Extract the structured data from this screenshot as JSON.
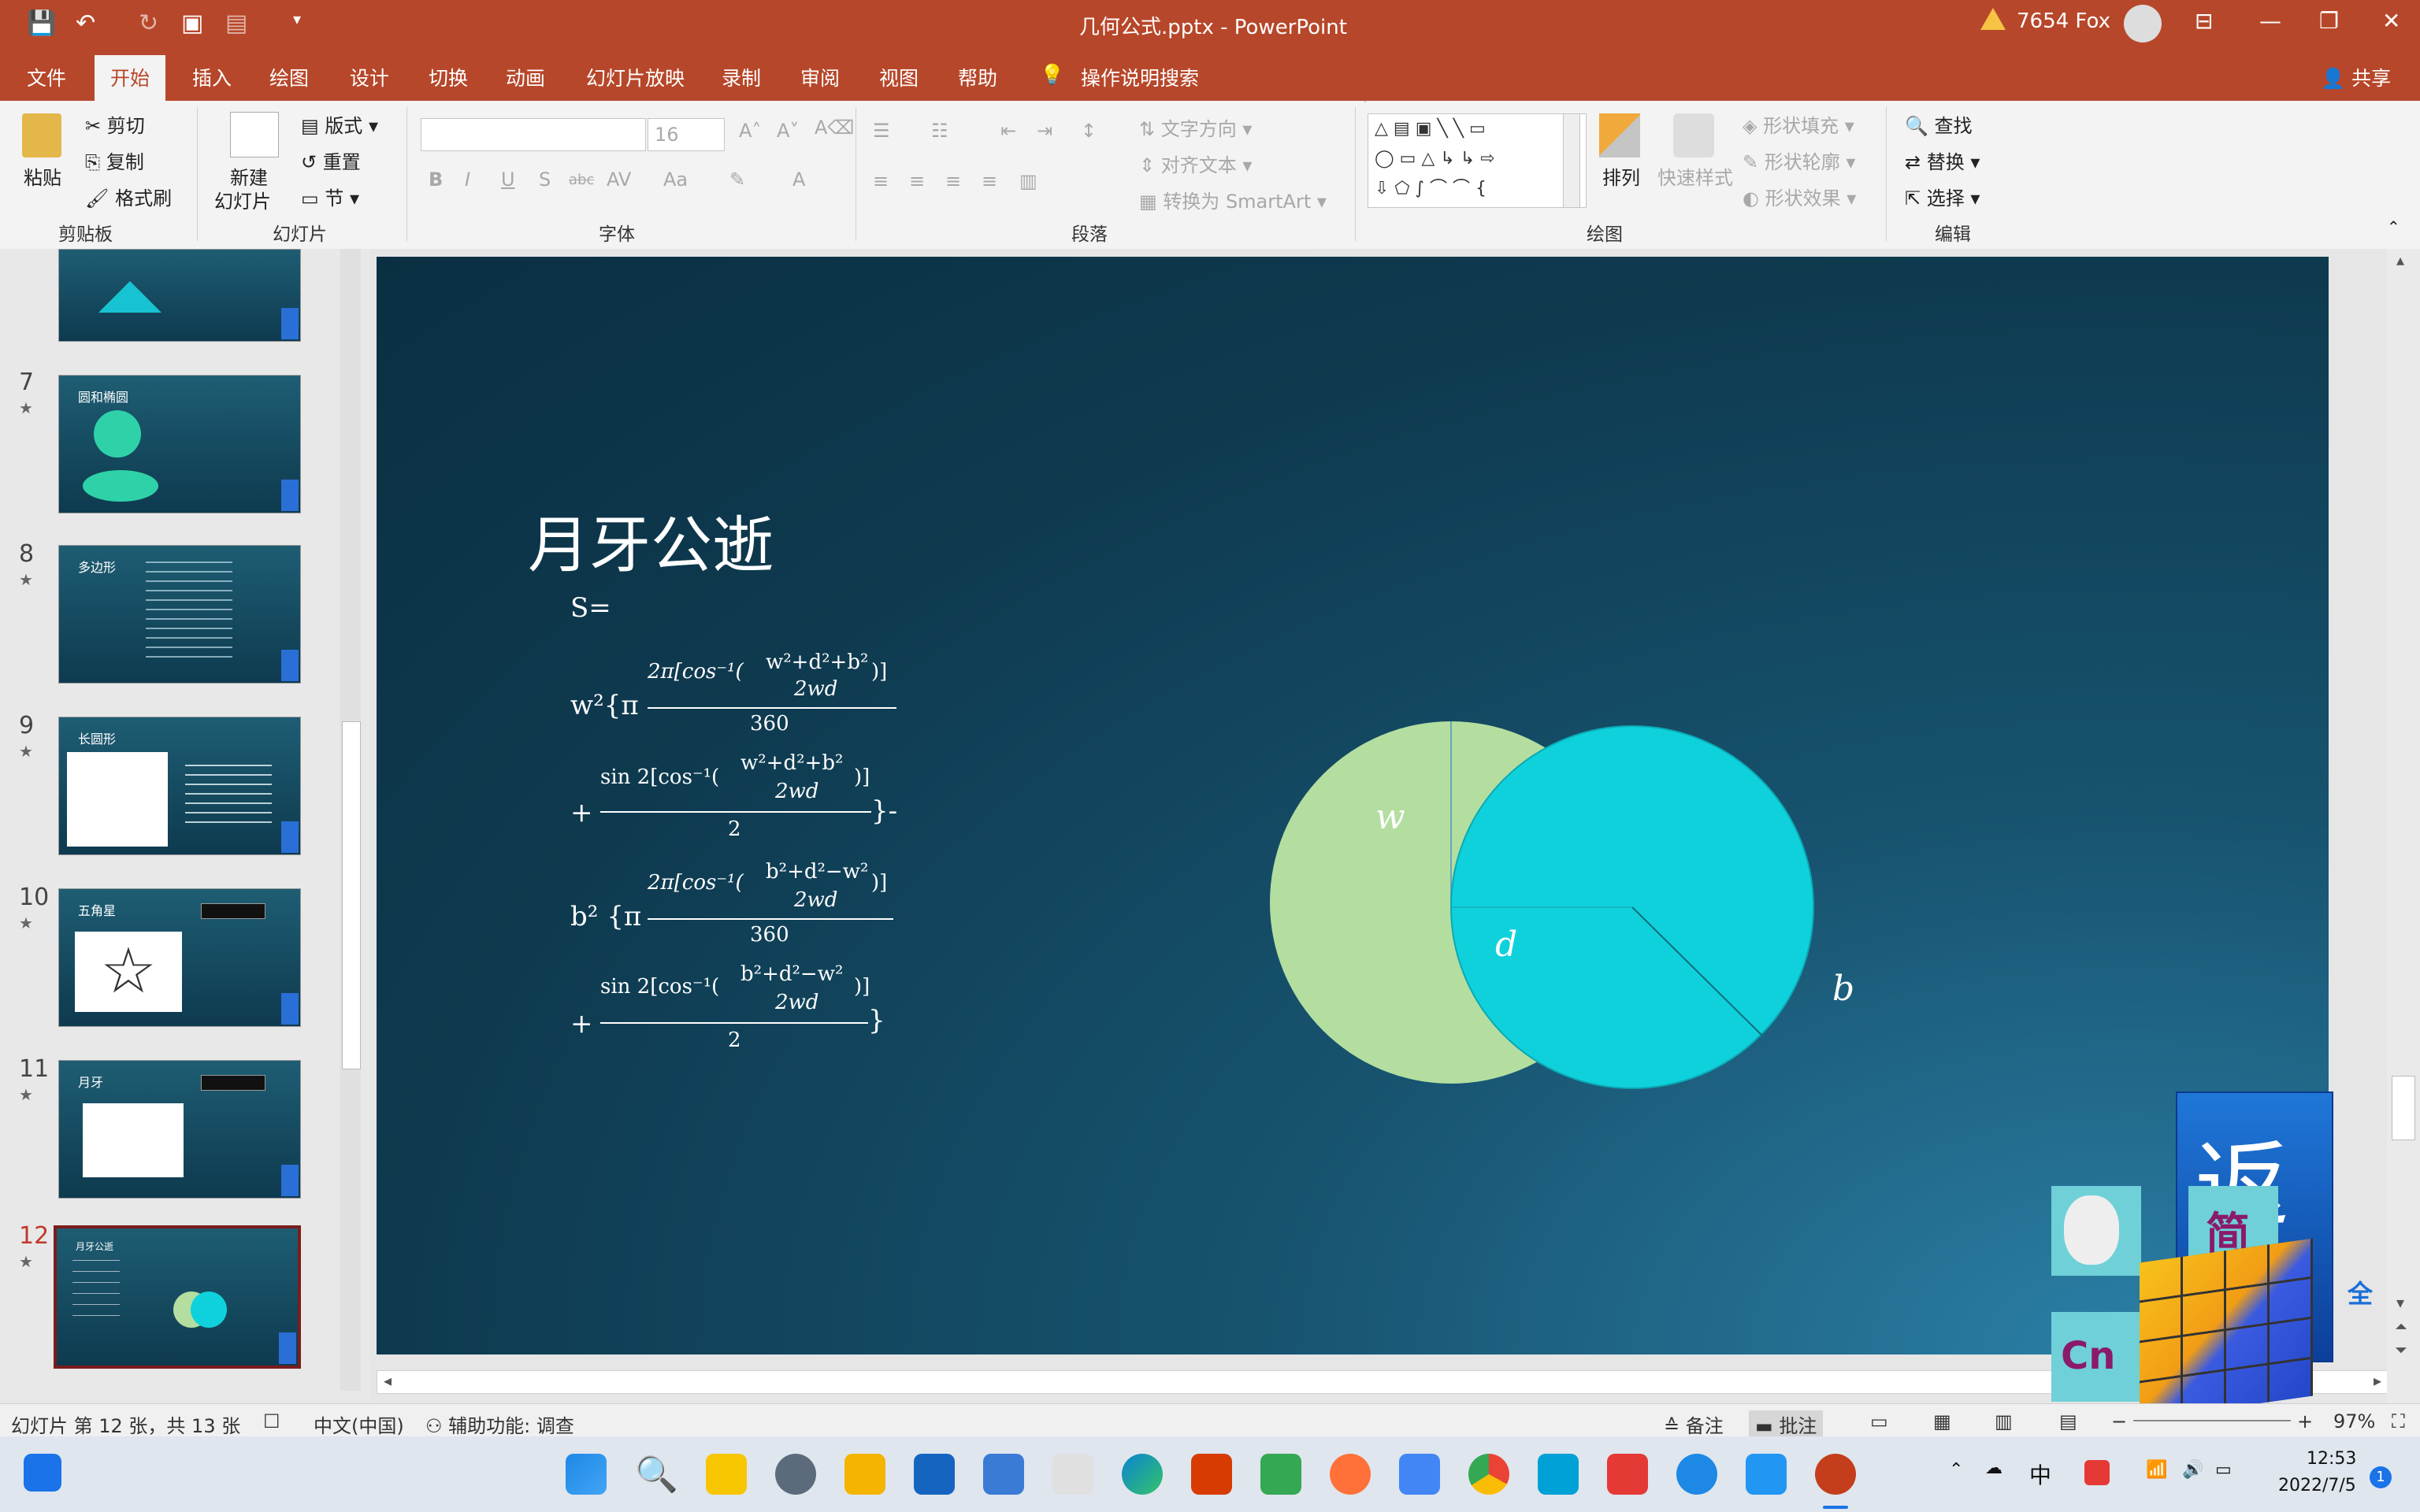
{
  "titlebar": {
    "app_title": "几何公式.pptx  -  PowerPoint",
    "user": "7654 Fox"
  },
  "tabs": [
    "文件",
    "开始",
    "插入",
    "绘图",
    "设计",
    "切换",
    "动画",
    "幻灯片放映",
    "录制",
    "审阅",
    "视图",
    "帮助"
  ],
  "tell_me": "操作说明搜索",
  "share": "共享",
  "ribbon": {
    "clipboard": {
      "paste": "粘贴",
      "cut": "剪切",
      "copy": "复制",
      "format_painter": "格式刷",
      "group": "剪贴板"
    },
    "slides": {
      "new_slide_1": "新建",
      "new_slide_2": "幻灯片",
      "layout": "版式",
      "reset": "重置",
      "section": "节",
      "group": "幻灯片"
    },
    "font": {
      "size": "16",
      "group": "字体"
    },
    "paragraph": {
      "text_direction": "文字方向",
      "align_text": "对齐文本",
      "smartart": "转换为 SmartArt",
      "group": "段落"
    },
    "drawing": {
      "arrange": "排列",
      "quick_styles": "快速样式",
      "shape_fill": "形状填充",
      "shape_outline": "形状轮廓",
      "shape_effects": "形状效果",
      "group": "绘图"
    },
    "editing": {
      "find": "查找",
      "replace": "替换",
      "select": "选择",
      "group": "编辑"
    }
  },
  "thumbnails": [
    {
      "num": "7",
      "title": "圆和椭圆"
    },
    {
      "num": "8",
      "title": "多边形"
    },
    {
      "num": "9",
      "title": "长圆形"
    },
    {
      "num": "10",
      "title": "五角星"
    },
    {
      "num": "11",
      "title": "月牙"
    },
    {
      "num": "12",
      "title": "月牙公逝"
    }
  ],
  "slide": {
    "title": "月牙公逝",
    "s_eq": "S=",
    "formula": {
      "w2": "w²{π",
      "num1": "2π[cos⁻¹(",
      "frac_top_w": "w²+d²+b²",
      "frac_bot": "2wd",
      "close": ")]",
      "den360": "360",
      "plus": "+",
      "sin": "sin 2[cos⁻¹(",
      "den2": "2",
      "close_brace_minus": "}-",
      "b2": "b² {π",
      "frac_top_b": "b²+d²−w²",
      "close_brace": "}"
    },
    "diagram": {
      "w": "w",
      "d": "d",
      "b": "b"
    }
  },
  "status": {
    "slide_info": "幻灯片 第 12 张，共 13 张",
    "lang": "中文(中国)",
    "accessibility": "辅助功能: 调查",
    "notes": "备注",
    "comments": "批注",
    "zoom": "97%"
  },
  "taskbar": {
    "ime": "中",
    "time": "12:53",
    "date": "2022/7/5",
    "badge": "1"
  },
  "ime_widget": {
    "fan": "返",
    "jian": "简",
    "cn": "Cn",
    "quan": "全"
  },
  "colors": {
    "accent": "#b7472a",
    "moon_left": "#b3dea0",
    "moon_right": "#0fd1dc"
  }
}
